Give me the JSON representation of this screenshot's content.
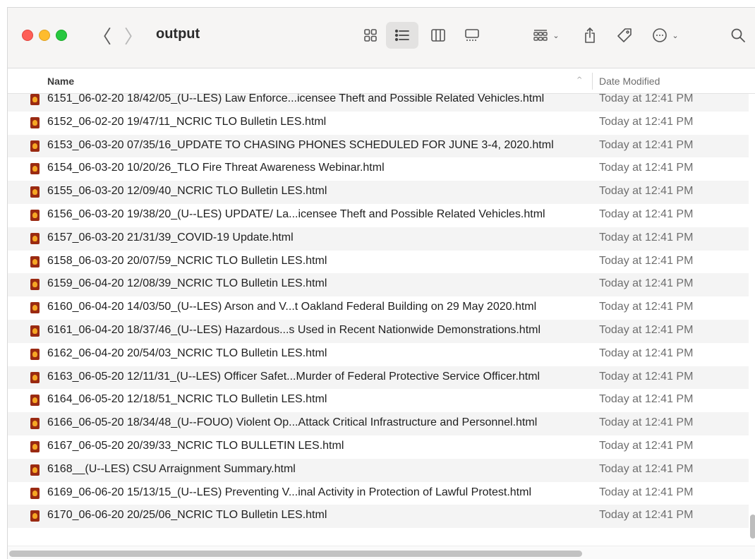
{
  "window": {
    "title": "output"
  },
  "toolbar": {
    "icons": [
      "back-chevron",
      "forward-chevron",
      "icon-view",
      "list-view",
      "column-view",
      "gallery-view",
      "group-by",
      "share",
      "tags",
      "more-actions",
      "search"
    ],
    "back_glyph": "〈",
    "forward_glyph": "〉",
    "active_view": "list",
    "chevron_glyph": "⌄"
  },
  "columns": {
    "name": "Name",
    "date_modified": "Date Modified",
    "sort_indicator": "^"
  },
  "files": [
    {
      "name": "6151_06-02-20 18/42/05_(U--LES) Law Enforce...icensee Theft and Possible Related Vehicles.html",
      "date": "Today at 12:41 PM"
    },
    {
      "name": "6152_06-02-20 19/47/11_NCRIC TLO Bulletin LES.html",
      "date": "Today at 12:41 PM"
    },
    {
      "name": "6153_06-03-20 07/35/16_UPDATE TO CHASING PHONES SCHEDULED FOR JUNE 3-4, 2020.html",
      "date": "Today at 12:41 PM"
    },
    {
      "name": "6154_06-03-20 10/20/26_TLO Fire Threat Awareness Webinar.html",
      "date": "Today at 12:41 PM"
    },
    {
      "name": "6155_06-03-20 12/09/40_NCRIC TLO Bulletin LES.html",
      "date": "Today at 12:41 PM"
    },
    {
      "name": "6156_06-03-20 19/38/20_(U--LES) UPDATE/ La...icensee Theft and Possible Related Vehicles.html",
      "date": "Today at 12:41 PM"
    },
    {
      "name": "6157_06-03-20 21/31/39_COVID-19 Update.html",
      "date": "Today at 12:41 PM"
    },
    {
      "name": "6158_06-03-20 20/07/59_NCRIC TLO Bulletin LES.html",
      "date": "Today at 12:41 PM"
    },
    {
      "name": "6159_06-04-20 12/08/39_NCRIC TLO Bulletin LES.html",
      "date": "Today at 12:41 PM"
    },
    {
      "name": "6160_06-04-20 14/03/50_(U--LES) Arson and V...t Oakland Federal Building on 29 May 2020.html",
      "date": "Today at 12:41 PM"
    },
    {
      "name": "6161_06-04-20 18/37/46_(U--LES) Hazardous...s Used in Recent Nationwide Demonstrations.html",
      "date": "Today at 12:41 PM"
    },
    {
      "name": "6162_06-04-20 20/54/03_NCRIC TLO Bulletin LES.html",
      "date": "Today at 12:41 PM"
    },
    {
      "name": "6163_06-05-20 12/11/31_(U--LES) Officer Safet...Murder of Federal Protective Service Officer.html",
      "date": "Today at 12:41 PM"
    },
    {
      "name": "6164_06-05-20 12/18/51_NCRIC TLO Bulletin LES.html",
      "date": "Today at 12:41 PM"
    },
    {
      "name": "6166_06-05-20 18/34/48_(U--FOUO) Violent Op...Attack Critical Infrastructure and Personnel.html",
      "date": "Today at 12:41 PM"
    },
    {
      "name": "6167_06-05-20 20/39/33_NCRIC TLO BULLETIN LES.html",
      "date": "Today at 12:41 PM"
    },
    {
      "name": "6168__(U--LES) CSU Arraignment Summary.html",
      "date": "Today at 12:41 PM"
    },
    {
      "name": "6169_06-06-20 15/13/15_(U--LES) Preventing V...inal Activity in Protection of Lawful Protest.html",
      "date": "Today at 12:41 PM"
    },
    {
      "name": "6170_06-06-20 20/25/06_NCRIC TLO Bulletin LES.html",
      "date": "Today at 12:41 PM"
    }
  ],
  "colors": {
    "close": "#fe5f57",
    "minimize": "#febc2e",
    "zoom": "#28c840",
    "file_icon": "#9a2a12",
    "row_alt": "#f4f4f4"
  }
}
